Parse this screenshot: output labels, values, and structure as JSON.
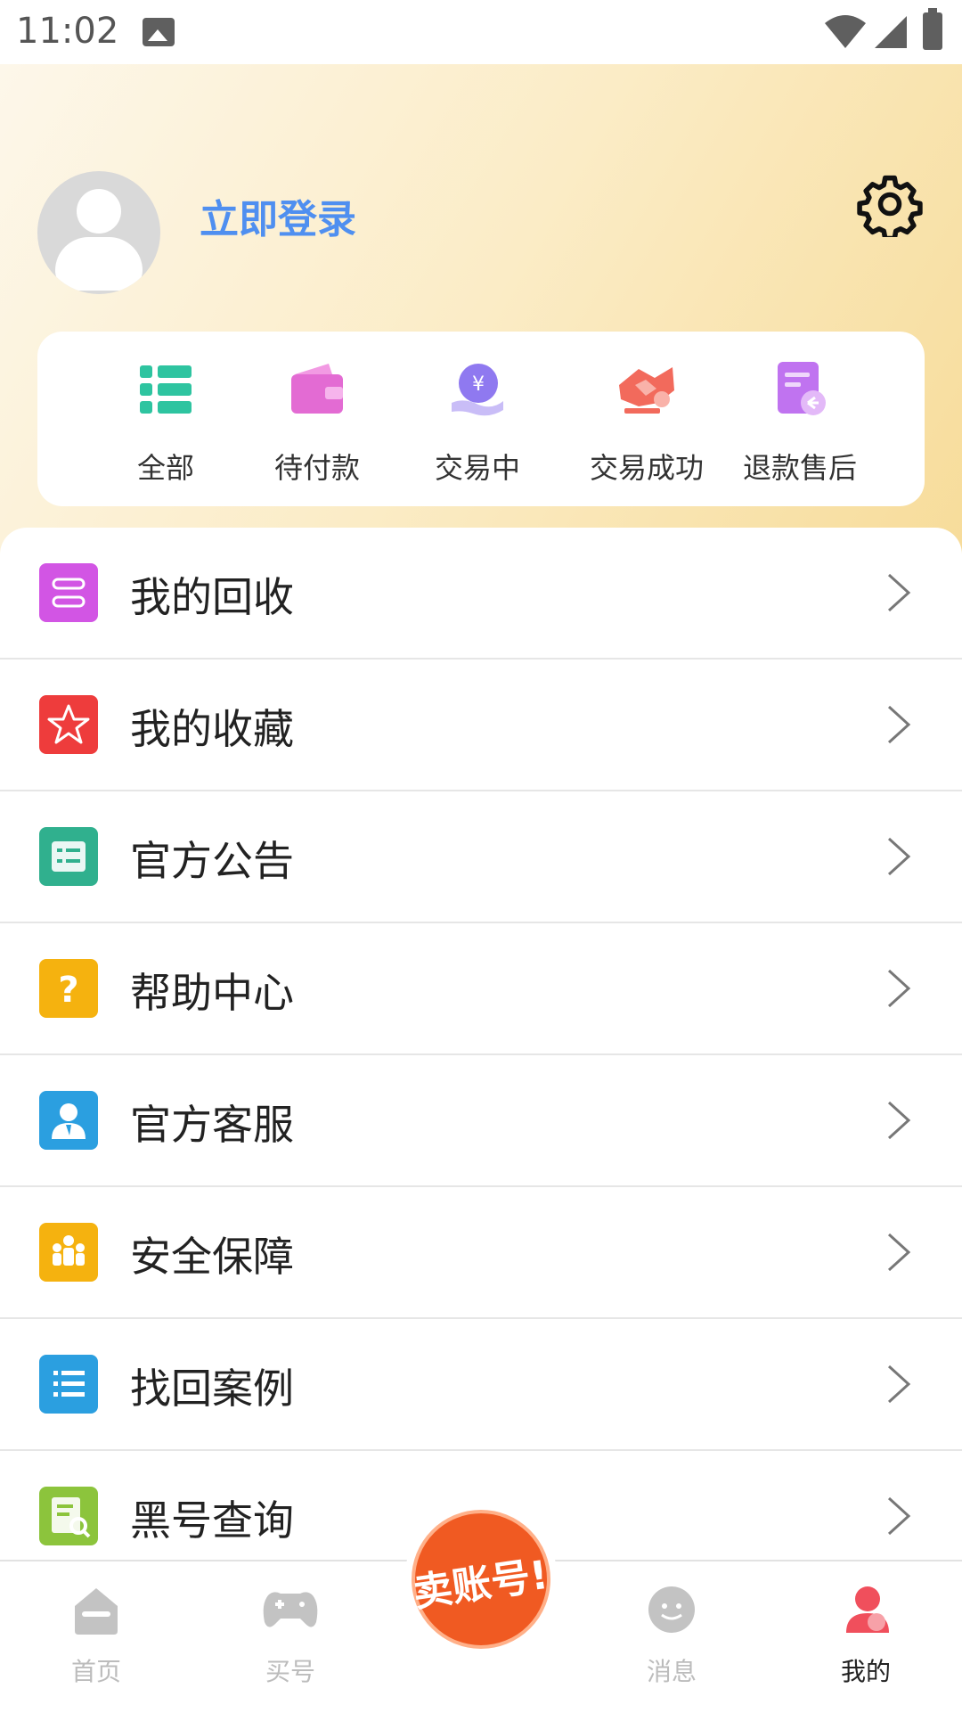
{
  "status_bar": {
    "time": "11:02"
  },
  "header": {
    "login_label": "立即登录"
  },
  "orders": [
    {
      "label": "全部",
      "icon": "list-grid-icon",
      "color": "#2ec4a0"
    },
    {
      "label": "待付款",
      "icon": "wallet-icon",
      "color": "#e36bd3"
    },
    {
      "label": "交易中",
      "icon": "yuan-hand-icon",
      "color": "#8f79f0"
    },
    {
      "label": "交易成功",
      "icon": "handshake-icon",
      "color": "#f26a5c"
    },
    {
      "label": "退款售后",
      "icon": "refund-doc-icon",
      "color": "#c073f0"
    }
  ],
  "menu": [
    {
      "label": "我的回收",
      "icon": "recycle-icon",
      "color": "#d255e4"
    },
    {
      "label": "我的收藏",
      "icon": "star-icon",
      "color": "#ee3c3c"
    },
    {
      "label": "官方公告",
      "icon": "notice-icon",
      "color": "#30b08e"
    },
    {
      "label": "帮助中心",
      "icon": "question-icon",
      "color": "#f5b20f"
    },
    {
      "label": "官方客服",
      "icon": "service-icon",
      "color": "#2b9fe0"
    },
    {
      "label": "安全保障",
      "icon": "shield-people-icon",
      "color": "#f5b20f"
    },
    {
      "label": "找回案例",
      "icon": "list-icon",
      "color": "#2b9fe0"
    },
    {
      "label": "黑号查询",
      "icon": "search-doc-icon",
      "color": "#8cc43c"
    }
  ],
  "bottom_nav": {
    "home": "首页",
    "buy": "买号",
    "sell": "卖账号!",
    "messages": "消息",
    "mine": "我的"
  }
}
